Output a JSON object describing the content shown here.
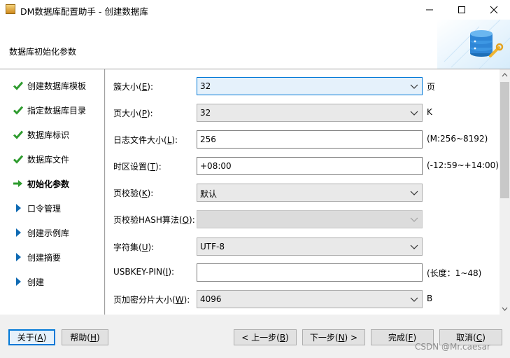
{
  "window": {
    "title": "DM数据库配置助手 - 创建数据库",
    "minimize_icon": "minimize-icon",
    "maximize_icon": "maximize-icon",
    "close_icon": "close-icon"
  },
  "header": {
    "title": "数据库初始化参数",
    "logo_icon": "database-settings-icon"
  },
  "steps": [
    {
      "label": "创建数据库模板",
      "status": "done",
      "icon": "check-icon"
    },
    {
      "label": "指定数据库目录",
      "status": "done",
      "icon": "check-icon"
    },
    {
      "label": "数据库标识",
      "status": "done",
      "icon": "check-icon"
    },
    {
      "label": "数据库文件",
      "status": "done",
      "icon": "check-icon"
    },
    {
      "label": "初始化参数",
      "status": "current",
      "icon": "arrow-right-icon"
    },
    {
      "label": "口令管理",
      "status": "pending",
      "icon": "triangle-right-icon"
    },
    {
      "label": "创建示例库",
      "status": "pending",
      "icon": "triangle-right-icon"
    },
    {
      "label": "创建摘要",
      "status": "pending",
      "icon": "triangle-right-icon"
    },
    {
      "label": "创建",
      "status": "pending",
      "icon": "triangle-right-icon"
    }
  ],
  "fields": [
    {
      "label_pre": "簇大小(",
      "mnemonic": "E",
      "label_post": "):",
      "value": "32",
      "suffix": "页",
      "type": "select",
      "state": "focused"
    },
    {
      "label_pre": "页大小(",
      "mnemonic": "P",
      "label_post": "):",
      "value": "32",
      "suffix": "K",
      "type": "select",
      "state": "normal"
    },
    {
      "label_pre": "日志文件大小(",
      "mnemonic": "L",
      "label_post": "):",
      "value": "256",
      "suffix": "(M:256~8192)",
      "type": "text",
      "state": "normal"
    },
    {
      "label_pre": "时区设置(",
      "mnemonic": "T",
      "label_post": "):",
      "value": "+08:00",
      "suffix": "(-12:59~+14:00)",
      "type": "text",
      "state": "normal"
    },
    {
      "label_pre": "页校验(",
      "mnemonic": "K",
      "label_post": "):",
      "value": "默认",
      "suffix": "",
      "type": "select",
      "state": "normal"
    },
    {
      "label_pre": "页校验HASH算法(",
      "mnemonic": "Q",
      "label_post": "):",
      "value": "",
      "suffix": "",
      "type": "select",
      "state": "disabled"
    },
    {
      "label_pre": "字符集(",
      "mnemonic": "U",
      "label_post": "):",
      "value": "UTF-8",
      "suffix": "",
      "type": "select",
      "state": "normal"
    },
    {
      "label_pre": "USBKEY-PIN(",
      "mnemonic": "I",
      "label_post": "):",
      "value": "",
      "suffix": "(长度：1~48)",
      "type": "text",
      "state": "normal"
    },
    {
      "label_pre": "页加密分片大小(",
      "mnemonic": "W",
      "label_post": "):",
      "value": "4096",
      "suffix": "B",
      "type": "select",
      "state": "normal"
    }
  ],
  "buttons": {
    "about": {
      "pre": "关于(",
      "key": "A",
      "post": ")"
    },
    "help": {
      "pre": "帮助(",
      "key": "H",
      "post": ")"
    },
    "back": {
      "pre": "< 上一步(",
      "key": "B",
      "post": ")"
    },
    "next": {
      "pre": "下一步(",
      "key": "N",
      "post": ") >"
    },
    "finish": {
      "pre": "完成(",
      "key": "F",
      "post": ")"
    },
    "cancel": {
      "pre": "取消(",
      "key": "C",
      "post": ")"
    }
  },
  "watermark": "CSDN @Mr.caesar",
  "colors": {
    "accent": "#0078d7",
    "check": "#2e9b2e",
    "step_arrow": "#0f6ab3"
  }
}
